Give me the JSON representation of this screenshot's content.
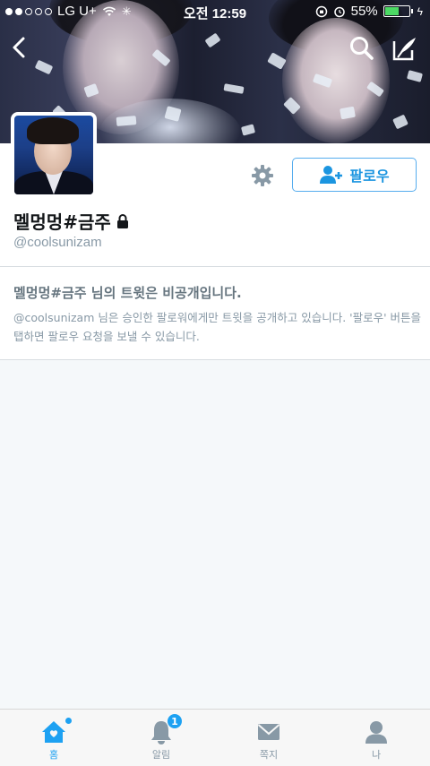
{
  "status_bar": {
    "carrier": "LG U+",
    "time": "오전 12:59",
    "battery": "55%"
  },
  "profile": {
    "display_name": "멜멍멍#금주",
    "handle": "@coolsunizam",
    "follow_label": "팔로우"
  },
  "protected_notice": {
    "title": "멜멍멍#금주 님의 트윗은 비공개입니다.",
    "description": "@coolsunizam 님은 승인한 팔로워에게만 트윗을 공개하고 있습니다. '팔로우' 버튼을 탭하면 팔로우 요청을 보낼 수 있습니다."
  },
  "tabbar": {
    "tabs": [
      {
        "label": "홈"
      },
      {
        "label": "알림",
        "badge": "1"
      },
      {
        "label": "쪽지"
      },
      {
        "label": "나"
      }
    ]
  },
  "colors": {
    "accent": "#1da1f2",
    "follow_border": "#55acee",
    "muted": "#8899a6"
  },
  "icons": [
    "back-icon",
    "search-icon",
    "compose-icon",
    "gear-icon",
    "add-user-icon",
    "lock-icon",
    "home-icon",
    "bell-icon",
    "envelope-icon",
    "person-icon"
  ]
}
